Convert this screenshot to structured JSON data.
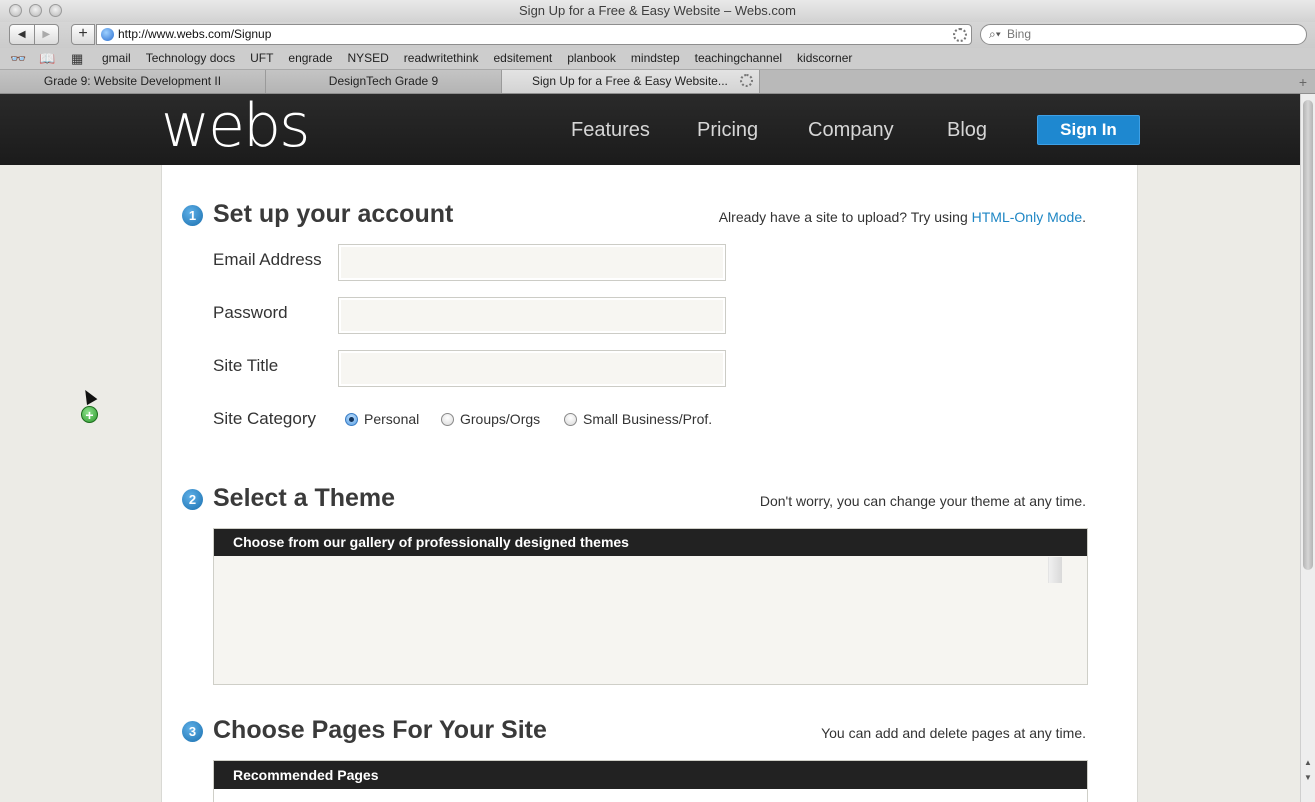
{
  "window": {
    "title": "Sign Up for a Free & Easy Website – Webs.com"
  },
  "toolbar": {
    "back_glyph": "◀",
    "forward_glyph": "▶",
    "add_glyph": "+",
    "url": "http://www.webs.com/Signup",
    "search_placeholder": "Bing",
    "search_glyph": "⌕▾"
  },
  "bookmarks": {
    "reader_glyph": "👓",
    "book_glyph": "📖",
    "grid_glyph": "▦",
    "items": [
      "gmail",
      "Technology docs",
      "UFT",
      "engrade",
      "NYSED",
      "readwritethink",
      "edsitement",
      "planbook",
      "mindstep",
      "teachingchannel",
      "kidscorner"
    ]
  },
  "tabs": {
    "items": [
      "Grade 9: Website Development II",
      "DesignTech Grade 9",
      "Sign Up for a Free & Easy Website..."
    ],
    "new_tab_glyph": "+"
  },
  "site": {
    "logo": "webs",
    "nav": [
      "Features",
      "Pricing",
      "Company",
      "Blog"
    ],
    "signin": "Sign In"
  },
  "step1": {
    "number": "1",
    "title": "Set up your account",
    "note_prefix": "Already have a site to upload? Try using ",
    "note_link": "HTML-Only Mode",
    "note_suffix": ".",
    "email_label": "Email Address",
    "password_label": "Password",
    "site_title_label": "Site Title",
    "email_value": "",
    "password_value": "",
    "site_title_value": "",
    "category_label": "Site Category",
    "category_options": [
      "Personal",
      "Groups/Orgs",
      "Small Business/Prof."
    ],
    "category_selected": "Personal"
  },
  "step2": {
    "number": "2",
    "title": "Select a Theme",
    "note": "Don't worry, you can change your theme at any time.",
    "gallery_header": "Choose from our gallery of professionally designed themes"
  },
  "step3": {
    "number": "3",
    "title": "Choose Pages For Your Site",
    "note": "You can add and delete pages at any time.",
    "pages_header": "Recommended Pages"
  },
  "scrollbar": {
    "up_glyph": "▲",
    "down_glyph": "▼"
  },
  "cursor": {
    "plus_glyph": "+"
  }
}
